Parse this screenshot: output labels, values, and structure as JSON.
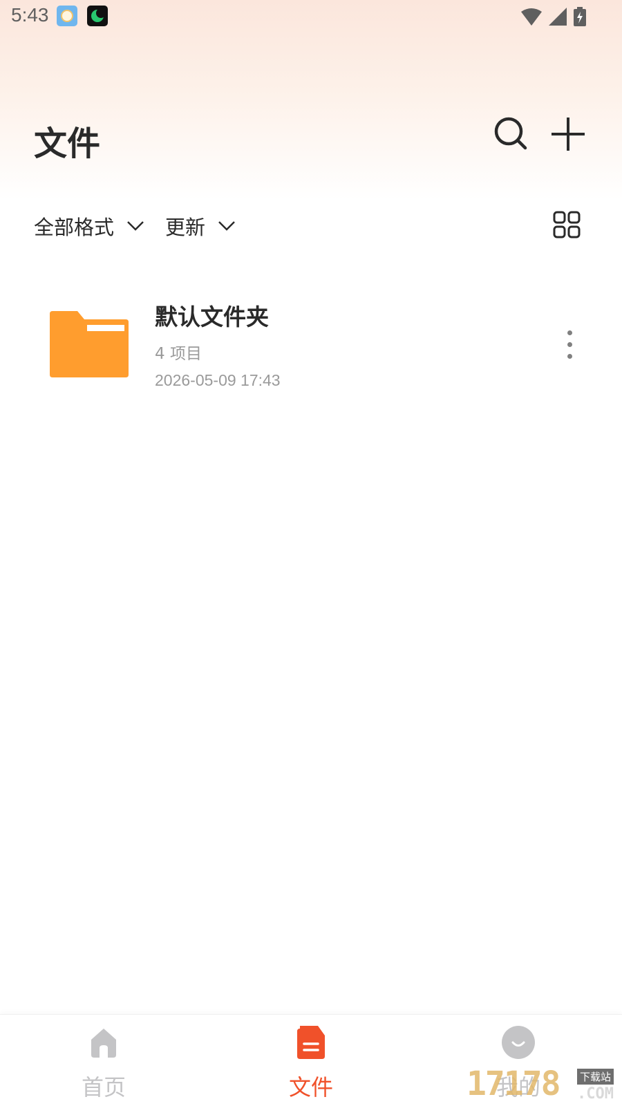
{
  "status_bar": {
    "time": "5:43"
  },
  "header": {
    "title": "文件"
  },
  "filters": {
    "format_label": "全部格式",
    "sort_label": "更新"
  },
  "folders": [
    {
      "name": "默认文件夹",
      "count": "4 项目",
      "date": "2026-05-09 17:43"
    }
  ],
  "bottom_nav": {
    "items": [
      {
        "label": "首页",
        "icon": "home-icon",
        "active": false
      },
      {
        "label": "文件",
        "icon": "document-icon",
        "active": true
      },
      {
        "label": "我的",
        "icon": "profile-icon",
        "active": false
      }
    ]
  },
  "watermark": {
    "number": "17178",
    "tag": "下载站",
    "suffix": ".COM"
  },
  "colors": {
    "accent": "#f0512a",
    "folder": "#ff9d2e",
    "inactive": "#c4c4c6",
    "text_primary": "#2a2a2a",
    "text_secondary": "#9a9a9a"
  }
}
